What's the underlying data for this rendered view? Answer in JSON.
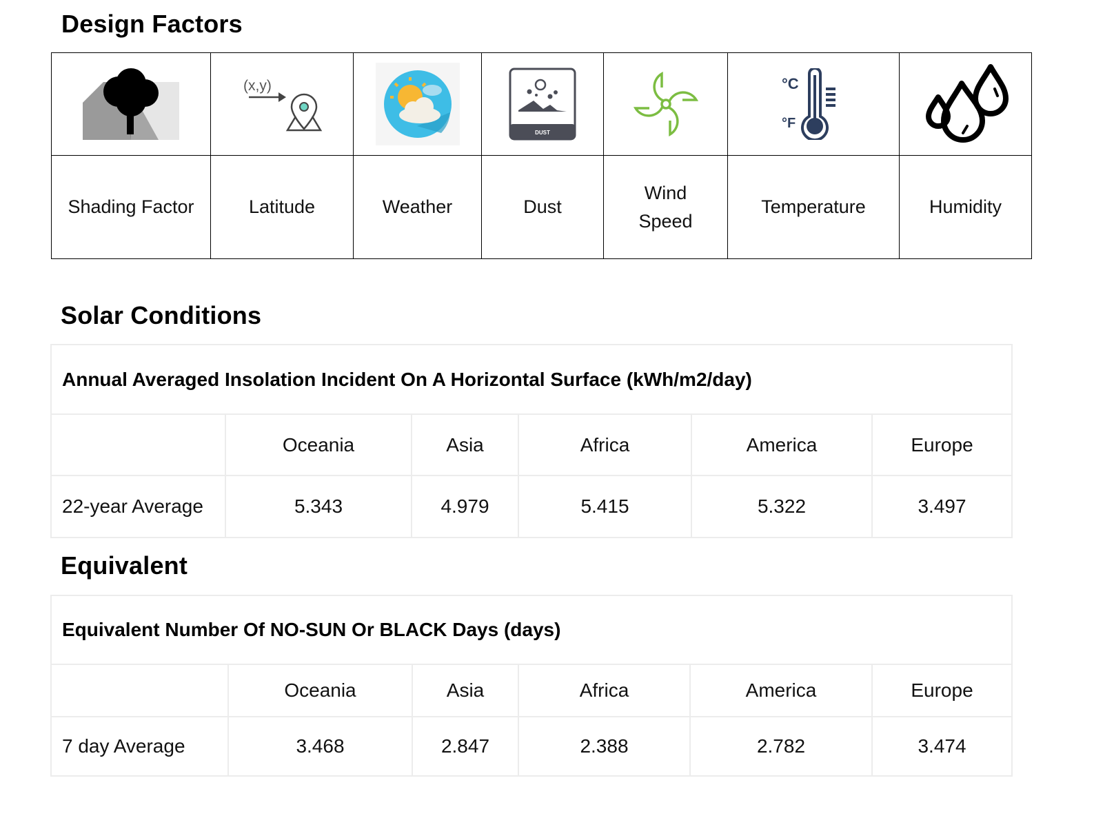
{
  "design_factors": {
    "title": "Design Factors",
    "items": [
      {
        "label": "Shading Factor",
        "icon": "tree-shade-icon"
      },
      {
        "label": "Latitude",
        "icon": "location-pin-coordinates-icon",
        "icon_text": "(x,y)"
      },
      {
        "label": "Weather",
        "icon": "sun-cloud-icon"
      },
      {
        "label": "Dust",
        "icon": "dust-icon",
        "icon_text": "DUST"
      },
      {
        "label": "Wind Speed",
        "label_line1": "Wind",
        "label_line2": "Speed",
        "icon": "fan-icon"
      },
      {
        "label": "Temperature",
        "icon": "thermometer-icon",
        "icon_text_c": "°C",
        "icon_text_f": "°F"
      },
      {
        "label": "Humidity",
        "icon": "water-drops-icon"
      }
    ],
    "colors": {
      "fan_green": "#7cbd42",
      "thermo_navy": "#2d3e5e",
      "weather_blue": "#3ebde6",
      "sun_yellow": "#f7b733",
      "pin_teal": "#6fd6c4"
    }
  },
  "solar_conditions": {
    "title": "Solar Conditions",
    "caption": "Annual Averaged Insolation Incident On A Horizontal Surface (kWh/m2/day)",
    "columns": [
      "Oceania",
      "Asia",
      "Africa",
      "America",
      "Europe"
    ],
    "row_label": "22-year Average",
    "values": [
      "5.343",
      "4.979",
      "5.415",
      "5.322",
      "3.497"
    ]
  },
  "equivalent": {
    "title": "Equivalent",
    "caption": "Equivalent Number Of NO-SUN Or BLACK Days (days)",
    "columns": [
      "Oceania",
      "Asia",
      "Africa",
      "America",
      "Europe"
    ],
    "row_label": "7 day Average",
    "values": [
      "3.468",
      "2.847",
      "2.388",
      "2.782",
      "3.474"
    ]
  }
}
